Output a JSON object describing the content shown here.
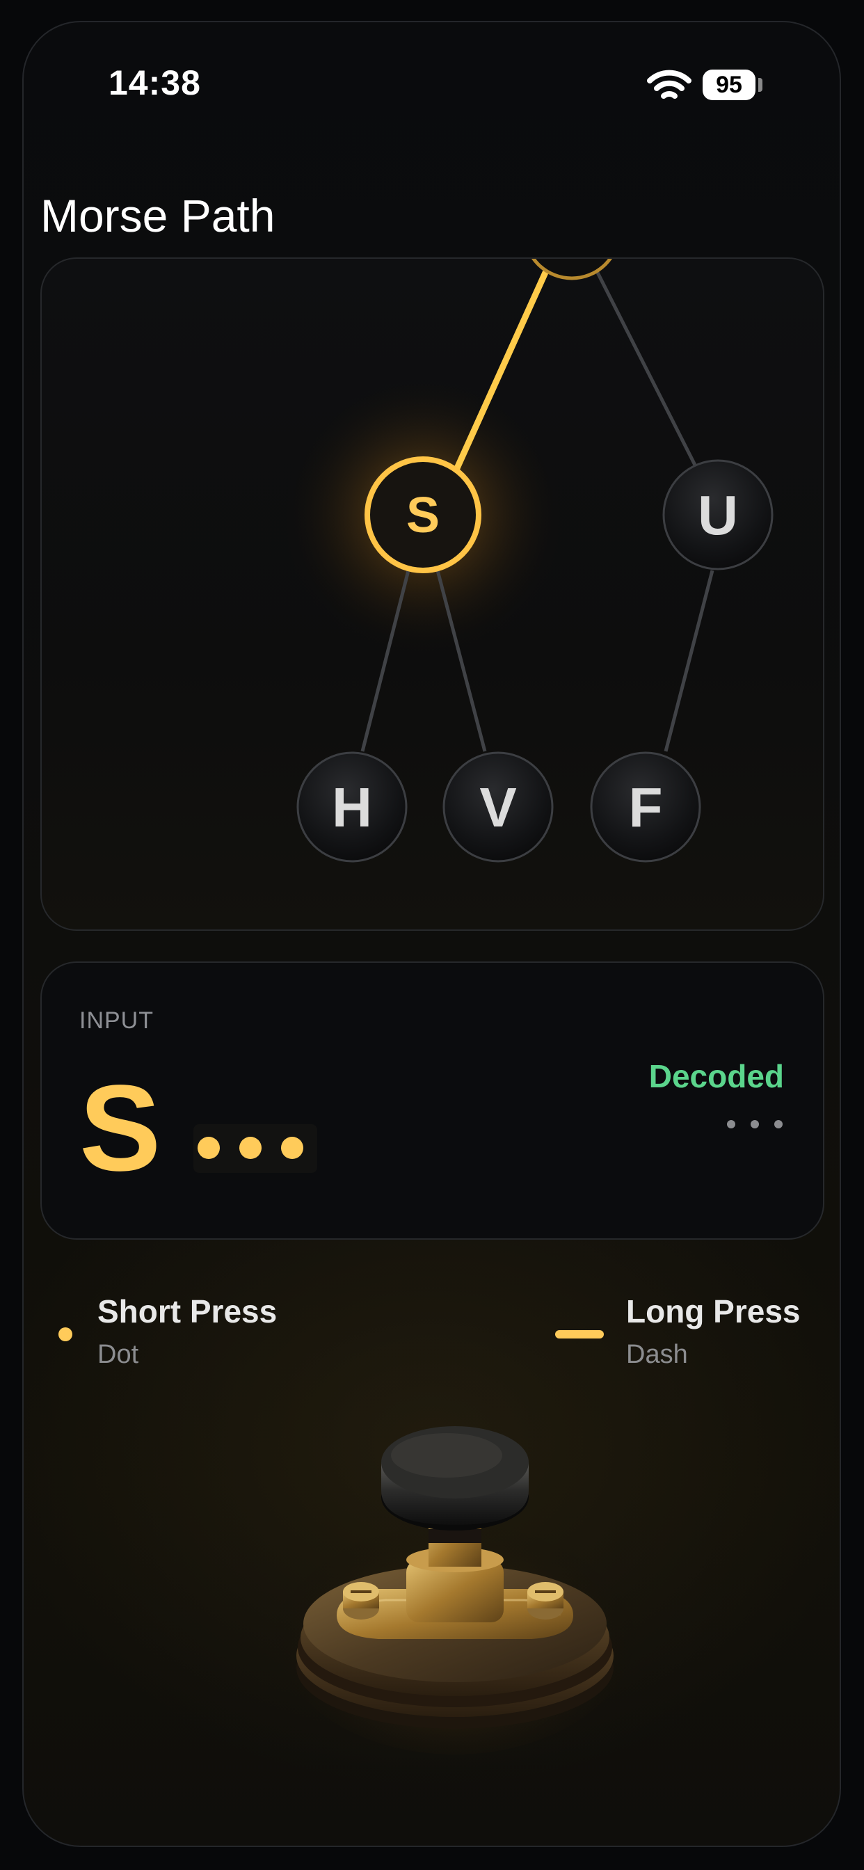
{
  "status_bar": {
    "time": "14:38",
    "battery": "95"
  },
  "page": {
    "title": "Morse Path"
  },
  "tree": {
    "active_path": [
      "S"
    ],
    "nodes": [
      {
        "label": "S",
        "active": true
      },
      {
        "label": "U",
        "active": false
      },
      {
        "label": "H",
        "active": false
      },
      {
        "label": "V",
        "active": false
      },
      {
        "label": "F",
        "active": false
      }
    ]
  },
  "input_panel": {
    "label": "INPUT",
    "current_letter": "S",
    "sequence": [
      "dot",
      "dot",
      "dot"
    ],
    "status": "Decoded"
  },
  "legend": {
    "short": {
      "title": "Short Press",
      "subtitle": "Dot"
    },
    "long": {
      "title": "Long Press",
      "subtitle": "Dash"
    }
  },
  "colors": {
    "accent": "#ffcb5a",
    "decoded": "#5bd58c",
    "background": "#0a0b0d"
  },
  "icons": [
    "wifi-icon",
    "battery-icon",
    "telegraph-key-icon"
  ]
}
